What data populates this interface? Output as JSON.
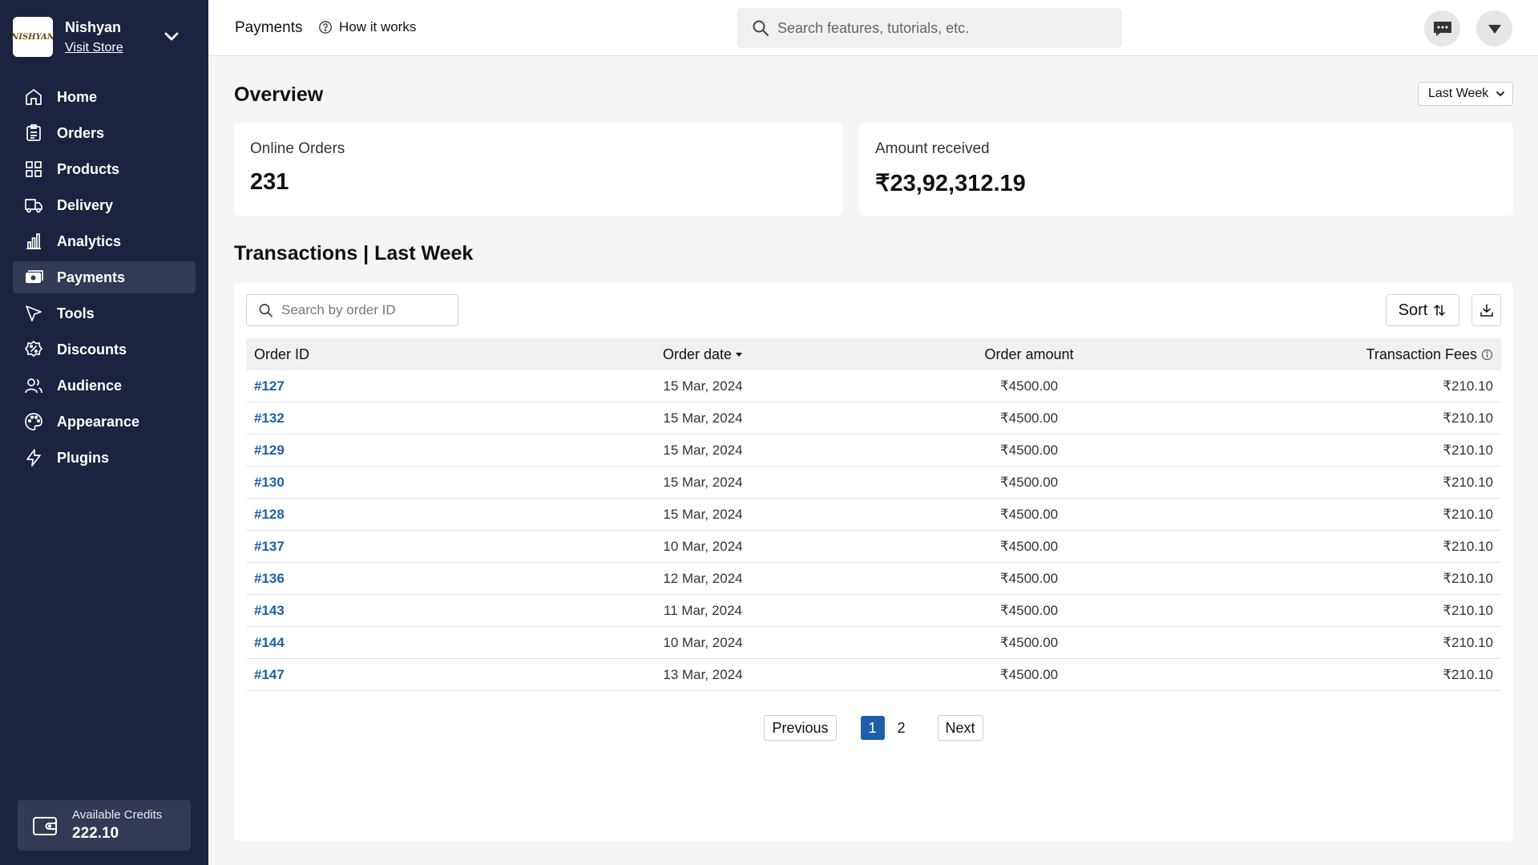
{
  "sidebar": {
    "store_name": "Nishyan",
    "store_link": "Visit Store",
    "logo_text": "NISHYAN",
    "items": [
      {
        "label": "Home",
        "icon": "home-icon"
      },
      {
        "label": "Orders",
        "icon": "orders-icon"
      },
      {
        "label": "Products",
        "icon": "products-icon"
      },
      {
        "label": "Delivery",
        "icon": "truck-icon"
      },
      {
        "label": "Analytics",
        "icon": "analytics-icon"
      },
      {
        "label": "Payments",
        "icon": "payments-icon",
        "active": true
      },
      {
        "label": "Tools",
        "icon": "tools-icon"
      },
      {
        "label": "Discounts",
        "icon": "discount-icon"
      },
      {
        "label": "Audience",
        "icon": "audience-icon"
      },
      {
        "label": "Appearance",
        "icon": "palette-icon"
      },
      {
        "label": "Plugins",
        "icon": "plugins-icon"
      }
    ],
    "credits_label": "Available Credits",
    "credits_value": "222.10"
  },
  "topbar": {
    "breadcrumb": "Payments",
    "how_it_works": "How it works",
    "search_placeholder": "Search features, tutorials, etc."
  },
  "overview": {
    "title": "Overview",
    "period": "Last Week",
    "cards": [
      {
        "label": "Online Orders",
        "value": "231"
      },
      {
        "label": "Amount received",
        "value": "₹23,92,312.19"
      }
    ]
  },
  "transactions": {
    "title": "Transactions | Last Week",
    "search_placeholder": "Search by order ID",
    "sort_label": "Sort",
    "columns": [
      "Order ID",
      "Order date",
      "Order amount",
      "Transaction Fees"
    ],
    "rows": [
      {
        "id": "#127",
        "date": "15 Mar, 2024",
        "amount": "₹4500.00",
        "fees": "₹210.10"
      },
      {
        "id": "#132",
        "date": "15 Mar, 2024",
        "amount": "₹4500.00",
        "fees": "₹210.10"
      },
      {
        "id": "#129",
        "date": "15 Mar, 2024",
        "amount": "₹4500.00",
        "fees": "₹210.10"
      },
      {
        "id": "#130",
        "date": "15 Mar, 2024",
        "amount": "₹4500.00",
        "fees": "₹210.10"
      },
      {
        "id": "#128",
        "date": "15 Mar, 2024",
        "amount": "₹4500.00",
        "fees": "₹210.10"
      },
      {
        "id": "#137",
        "date": "10 Mar, 2024",
        "amount": "₹4500.00",
        "fees": "₹210.10"
      },
      {
        "id": "#136",
        "date": "12 Mar, 2024",
        "amount": "₹4500.00",
        "fees": "₹210.10"
      },
      {
        "id": "#143",
        "date": "11 Mar, 2024",
        "amount": "₹4500.00",
        "fees": "₹210.10"
      },
      {
        "id": "#144",
        "date": "10 Mar, 2024",
        "amount": "₹4500.00",
        "fees": "₹210.10"
      },
      {
        "id": "#147",
        "date": "13 Mar, 2024",
        "amount": "₹4500.00",
        "fees": "₹210.10"
      }
    ],
    "pagination": {
      "previous": "Previous",
      "pages": [
        "1",
        "2"
      ],
      "current": "1",
      "next": "Next"
    }
  },
  "colors": {
    "sidebar_bg": "#1c2340",
    "sidebar_active": "#333a55",
    "link": "#1f5fa8",
    "page_bg": "#f5f5f5"
  }
}
